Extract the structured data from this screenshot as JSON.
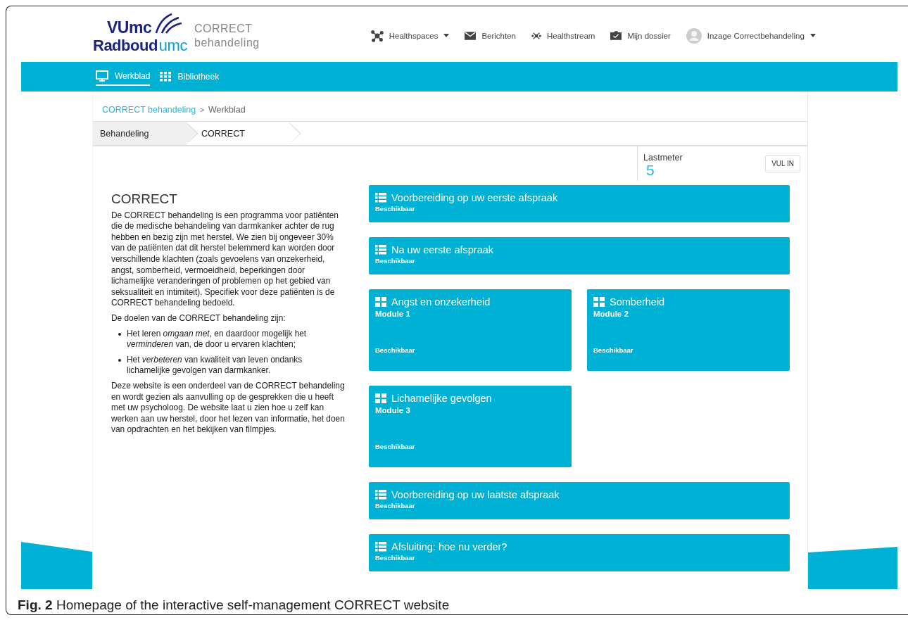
{
  "logo": {
    "top": "VUmc",
    "bottom_main": "Radboud",
    "bottom_accent": "umc"
  },
  "app_name": {
    "title": "CORRECT",
    "subtitle": "behandeling"
  },
  "top_nav": [
    {
      "kind": "network",
      "label": "Healthspaces",
      "dropdown": true
    },
    {
      "kind": "mail",
      "label": "Berichten",
      "dropdown": false
    },
    {
      "kind": "stream",
      "label": "Healthstream",
      "dropdown": false
    },
    {
      "kind": "folder",
      "label": "Mijn dossier",
      "dropdown": false
    },
    {
      "kind": "avatar",
      "label": "Inzage Correctbehandeling",
      "dropdown": true
    }
  ],
  "sub_nav": [
    {
      "kind": "monitor",
      "label": "Werkblad"
    },
    {
      "kind": "grid",
      "label": "Bibliotheek"
    }
  ],
  "breadcrumb": [
    {
      "kind": "link",
      "label": "CORRECT behandeling"
    },
    {
      "kind": "separator",
      "label": ">"
    },
    {
      "kind": "current",
      "label": "Werkblad"
    }
  ],
  "steps": [
    {
      "label": "Behandeling",
      "selected": true
    },
    {
      "label": "CORRECT",
      "selected": false
    }
  ],
  "lastmeter": {
    "label": "Lastmeter",
    "value": "5",
    "button": "VUL IN"
  },
  "intro": {
    "title": "CORRECT",
    "paragraph": "De CORRECT behandeling is een programma voor patiënten die de medische behandeling van darmkanker achter de rug hebben en bezig zijn met herstel. We zien bij ongeveer 30% van de patiënten dat dit herstel belemmerd kan worden door verschillende klachten (zoals gevoelens van onzekerheid, angst, somberheid, vermoeidheid, beperkingen door lichamelijke veranderingen of problemen op het gebied van seksualiteit en intimiteit). Specifiek voor deze patiënten is de CORRECT behandeling bedoeld.",
    "goals_intro": "De doelen van de CORRECT behandeling zijn:",
    "goals": [
      "Het leren *omgaan met*, en daardoor mogelijk het *verminderen* van, de door u ervaren klachten;",
      "Het *verbeteren* van kwaliteit van leven ondanks lichamelijke gevolgen van darmkanker."
    ],
    "closing": "Deze website is een onderdeel van de CORRECT behandeling en wordt gezien als aanvulling op de gesprekken die u heeft met uw psycholoog. De website laat u zien hoe u zelf kan werken aan uw herstel, door het lezen van informatie, het doen van opdrachten en het bekijken van filmpjes."
  },
  "cards": [
    {
      "kind": "wide",
      "title": "Voorbereiding op uw eerste afspraak",
      "status": "Beschikbaar"
    },
    {
      "kind": "wide",
      "title": "Na uw eerste afspraak",
      "status": "Beschikbaar"
    },
    {
      "kind": "module",
      "title": "Angst en onzekerheid",
      "module": "Module 1",
      "status": "Beschikbaar"
    },
    {
      "kind": "module",
      "title": "Somberheid",
      "module": "Module 2",
      "status": "Beschikbaar"
    },
    {
      "kind": "module",
      "title": "Lichamelijke gevolgen",
      "module": "Module 3",
      "status": "Beschikbaar"
    },
    {
      "kind": "wide",
      "title": "Voorbereiding op uw laatste afspraak",
      "status": "Beschikbaar"
    },
    {
      "kind": "wide",
      "title": "Afsluiting: hoe nu verder?",
      "status": "Beschikbaar"
    }
  ],
  "caption": "**Fig. 2** Homepage of the interactive self-management CORRECT website"
}
